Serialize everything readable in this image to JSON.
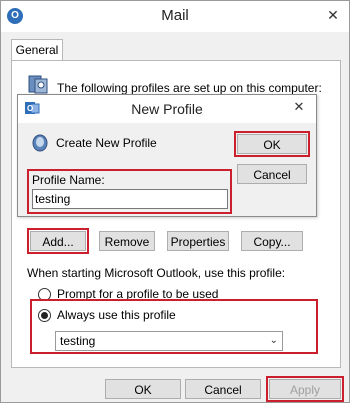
{
  "window": {
    "title": "Mail",
    "close_glyph": "✕",
    "icon": "mail-app-icon"
  },
  "tabs": [
    {
      "label": "General"
    }
  ],
  "profiles_text": "The following profiles are set up on this computer:",
  "new_profile_dialog": {
    "title": "New Profile",
    "close_glyph": "✕",
    "create_label": "Create New Profile",
    "ok_label": "OK",
    "cancel_label": "Cancel",
    "profile_name_label": "Profile Name:",
    "profile_name_value": "testing"
  },
  "profile_buttons": {
    "add_label": "Add...",
    "remove_label": "Remove",
    "properties_label": "Properties",
    "copy_label": "Copy..."
  },
  "startup_text": "When starting Microsoft Outlook, use this profile:",
  "radio_prompt_label": "Prompt for a profile to be used",
  "radio_always_label": "Always use this profile",
  "always_profile_select": {
    "selected": "testing",
    "arrow_glyph": "⌄"
  },
  "footer": {
    "ok_label": "OK",
    "cancel_label": "Cancel",
    "apply_label": "Apply"
  },
  "colors": {
    "highlight_red": "#cc1f2d",
    "dialog_bg": "#f0f0f0",
    "button_bg": "#e1e1e1"
  }
}
